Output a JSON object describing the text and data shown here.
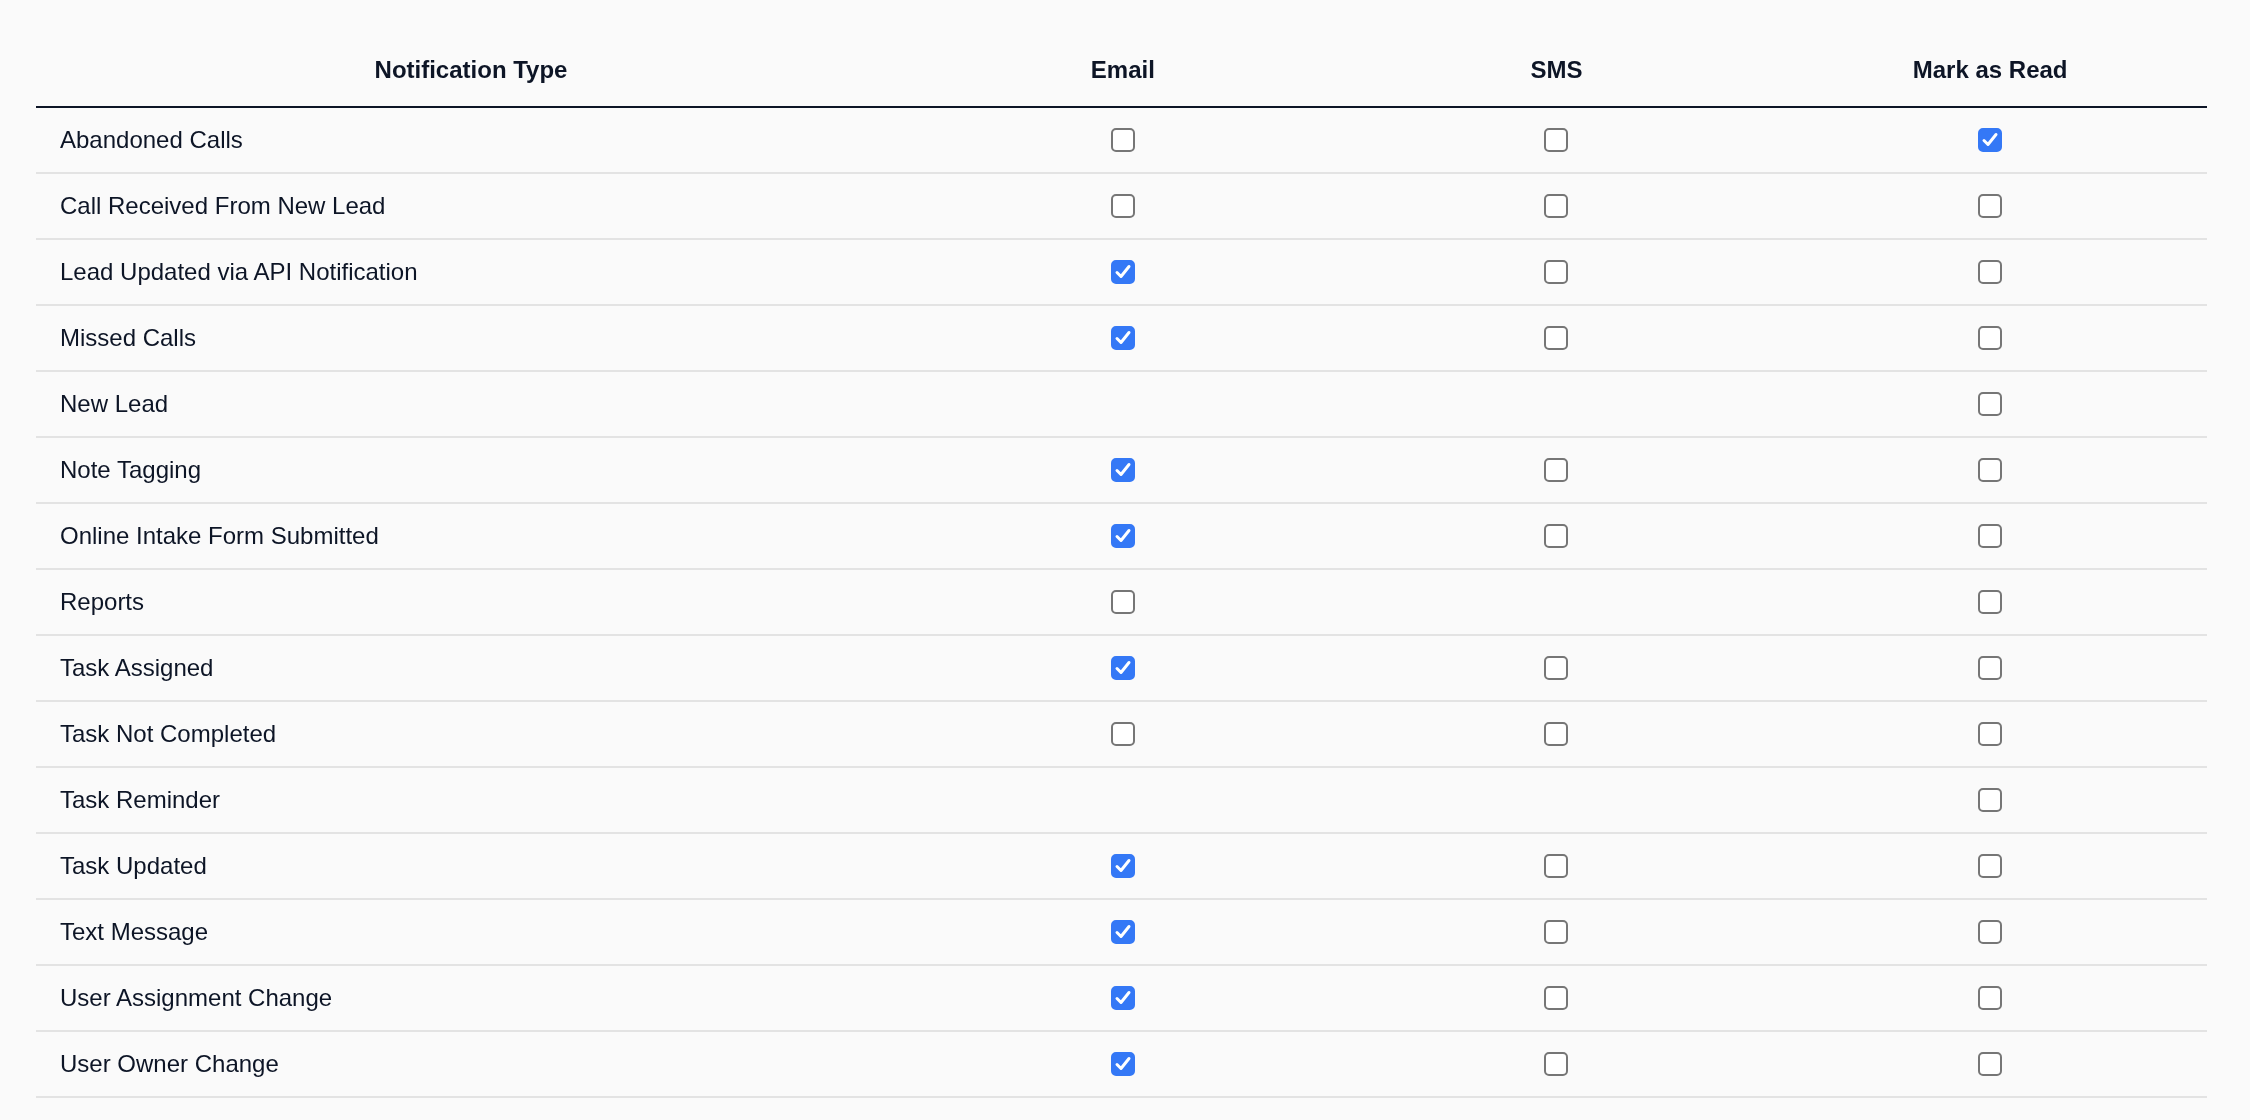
{
  "table": {
    "columns": [
      "Notification Type",
      "Email",
      "SMS",
      "Mark as Read"
    ],
    "rows": [
      {
        "name": "Abandoned Calls",
        "email": {
          "checked": false
        },
        "sms": {
          "checked": false
        },
        "mark_as_read": {
          "checked": true
        }
      },
      {
        "name": "Call Received From New Lead",
        "email": {
          "checked": false
        },
        "sms": {
          "checked": false
        },
        "mark_as_read": {
          "checked": false
        }
      },
      {
        "name": "Lead Updated via API Notification",
        "email": {
          "checked": true
        },
        "sms": {
          "checked": false
        },
        "mark_as_read": {
          "checked": false
        }
      },
      {
        "name": "Missed Calls",
        "email": {
          "checked": true
        },
        "sms": {
          "checked": false
        },
        "mark_as_read": {
          "checked": false
        }
      },
      {
        "name": "New Lead",
        "mark_as_read": {
          "checked": false
        }
      },
      {
        "name": "Note Tagging",
        "email": {
          "checked": true
        },
        "sms": {
          "checked": false
        },
        "mark_as_read": {
          "checked": false
        }
      },
      {
        "name": "Online Intake Form Submitted",
        "email": {
          "checked": true
        },
        "sms": {
          "checked": false
        },
        "mark_as_read": {
          "checked": false
        }
      },
      {
        "name": "Reports",
        "email": {
          "checked": false
        },
        "mark_as_read": {
          "checked": false
        }
      },
      {
        "name": "Task Assigned",
        "email": {
          "checked": true
        },
        "sms": {
          "checked": false
        },
        "mark_as_read": {
          "checked": false
        }
      },
      {
        "name": "Task Not Completed",
        "email": {
          "checked": false
        },
        "sms": {
          "checked": false
        },
        "mark_as_read": {
          "checked": false
        }
      },
      {
        "name": "Task Reminder",
        "mark_as_read": {
          "checked": false
        }
      },
      {
        "name": "Task Updated",
        "email": {
          "checked": true
        },
        "sms": {
          "checked": false
        },
        "mark_as_read": {
          "checked": false
        }
      },
      {
        "name": "Text Message",
        "email": {
          "checked": true
        },
        "sms": {
          "checked": false
        },
        "mark_as_read": {
          "checked": false
        }
      },
      {
        "name": "User Assignment Change",
        "email": {
          "checked": true
        },
        "sms": {
          "checked": false
        },
        "mark_as_read": {
          "checked": false
        }
      },
      {
        "name": "User Owner Change",
        "email": {
          "checked": true
        },
        "sms": {
          "checked": false
        },
        "mark_as_read": {
          "checked": false
        }
      }
    ]
  }
}
